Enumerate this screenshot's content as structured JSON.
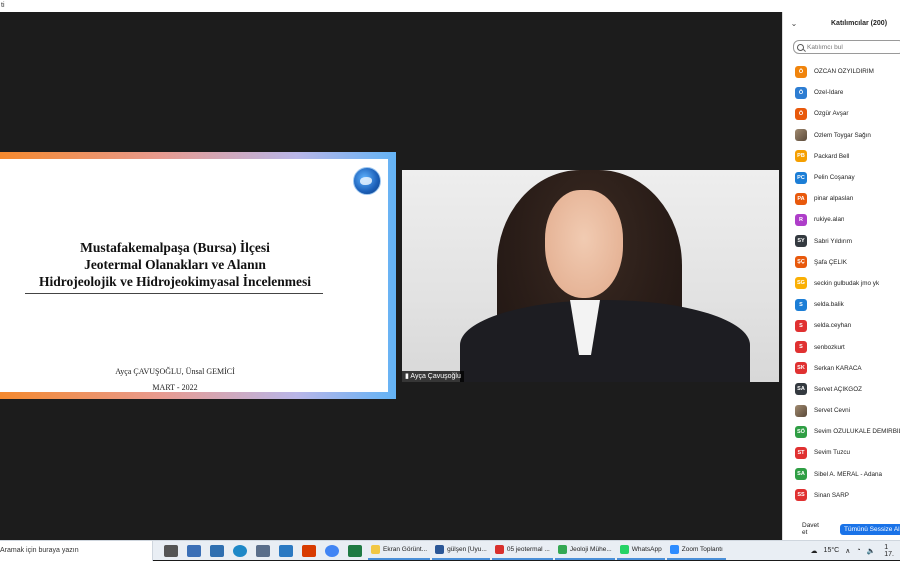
{
  "window": {
    "title": "ti"
  },
  "slide": {
    "title_lines": [
      "Mustafakemalpaşa (Bursa) İlçesi",
      "Jeotermal Olanakları ve Alanın",
      "Hidrojeolojik ve Hidrojeokimyasal İncelenmesi"
    ],
    "authors": "Ayça ÇAVUŞOĞLU, Ünsal GEMİCİ",
    "date": "MART - 2022"
  },
  "video": {
    "name_tag": "Ayça Çavuşoğlu"
  },
  "participants": {
    "title": "Katılımcılar (200)",
    "search_placeholder": "Katılımcı bul",
    "list": [
      {
        "initials": "Ö",
        "name": "ÖZCAN ÖZYILDIRIM",
        "color": "#f0840c"
      },
      {
        "initials": "Ö",
        "name": "Özel-İdare",
        "color": "#2d7dd2"
      },
      {
        "initials": "Ö",
        "name": "Özgür Avşar",
        "color": "#e8590c"
      },
      {
        "initials": "",
        "name": "Özlem Toygar Sağın",
        "color": "#8b7355"
      },
      {
        "initials": "PB",
        "name": "Packard Bell",
        "color": "#f59f00"
      },
      {
        "initials": "PC",
        "name": "Pelin Coşanay",
        "color": "#1c7ed6"
      },
      {
        "initials": "PA",
        "name": "pinar alpaslan",
        "color": "#e8590c"
      },
      {
        "initials": "R",
        "name": "rukiye.alan",
        "color": "#ae3ec9"
      },
      {
        "initials": "SY",
        "name": "Sabri Yıldırım",
        "color": "#343a40"
      },
      {
        "initials": "ŞÇ",
        "name": "Şafa ÇELİK",
        "color": "#e8590c"
      },
      {
        "initials": "SG",
        "name": "seckin gulbudak jmo yk",
        "color": "#fab005"
      },
      {
        "initials": "S",
        "name": "selda.balik",
        "color": "#1c7ed6"
      },
      {
        "initials": "S",
        "name": "selda.ceyhan",
        "color": "#e03131"
      },
      {
        "initials": "S",
        "name": "senbozkurt",
        "color": "#e03131"
      },
      {
        "initials": "SK",
        "name": "Serkan KARACA",
        "color": "#e03131"
      },
      {
        "initials": "SA",
        "name": "Servet AÇIKGÖZ",
        "color": "#343a40"
      },
      {
        "initials": "",
        "name": "Servet Cevni",
        "color": "#d9480f"
      },
      {
        "initials": "SÖ",
        "name": "Sevim ÖZULUKALE DEMİRBİL",
        "color": "#2f9e44"
      },
      {
        "initials": "ST",
        "name": "Sevim Tuzcu",
        "color": "#e03131"
      },
      {
        "initials": "SA",
        "name": "Sibel A. MERAL - Adana",
        "color": "#2f9e44"
      },
      {
        "initials": "SS",
        "name": "Sinan SARP",
        "color": "#e03131"
      }
    ],
    "invite_label": "Davet et",
    "mute_all_label": "Tümünü Sessize Al"
  },
  "taskbar": {
    "search_text": "Aramak için buraya yazın",
    "apps": [
      {
        "label": "Ekran Görünt...",
        "color": "#f2c744"
      },
      {
        "label": "gülşen [Uyu...",
        "color": "#2b5797"
      },
      {
        "label": "05 jeotermal ...",
        "color": "#d9302c"
      },
      {
        "label": "Jeoloji Mühe...",
        "color": "#34a853"
      },
      {
        "label": "WhatsApp",
        "color": "#25d366"
      },
      {
        "label": "Zoom Toplantı",
        "color": "#2d8cff"
      }
    ],
    "temperature": "15°C",
    "time": "1",
    "date": "17."
  }
}
